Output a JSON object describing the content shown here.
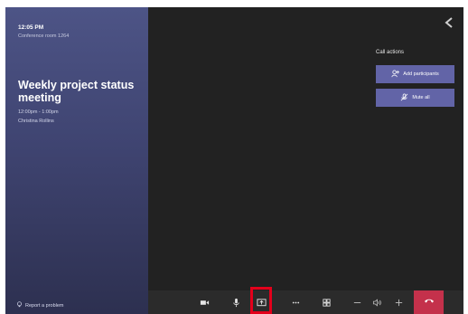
{
  "left_panel": {
    "time": "12:05 PM",
    "room": "Conference room 1264",
    "meeting_title": "Weekly project status meeting",
    "meeting_time": "12:00pm - 1:00pm",
    "organizer": "Christina Rollins",
    "report_link": "Report a problem"
  },
  "call_actions": {
    "label": "Call actions",
    "add_participants": "Add participants",
    "mute_all": "Mute all"
  },
  "toolbar": {
    "icons": [
      "video-camera-icon",
      "microphone-icon",
      "share-screen-icon",
      "more-options-icon",
      "layout-grid-icon",
      "volume-down-icon",
      "speaker-icon",
      "volume-up-icon",
      "hang-up-icon"
    ],
    "highlighted": "share-screen-icon"
  },
  "colors": {
    "accent": "#6264a7",
    "hangup": "#c4314b",
    "highlight": "#e3001b",
    "panel_top": "#4d5486",
    "background": "#222222"
  }
}
